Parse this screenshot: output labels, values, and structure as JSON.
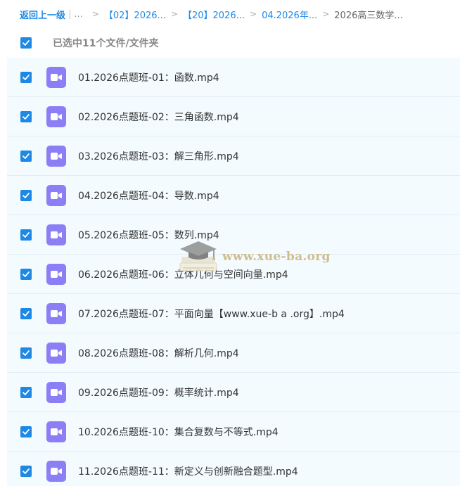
{
  "breadcrumb": {
    "back_label": "返回上一级",
    "separator": "|",
    "ellipsis": "...",
    "crumbs": [
      {
        "label": "【02】2026..."
      },
      {
        "label": "【20】2026..."
      },
      {
        "label": "04.2026年..."
      }
    ],
    "current": "2026高三数学..."
  },
  "selection": {
    "label": "已选中11个文件/文件夹",
    "all_checked": true
  },
  "files": [
    {
      "name": "01.2026点题班-01：函数.mp4",
      "checked": true,
      "icon": "video-file-icon"
    },
    {
      "name": "02.2026点题班-02：三角函数.mp4",
      "checked": true,
      "icon": "video-file-icon"
    },
    {
      "name": "03.2026点题班-03：解三角形.mp4",
      "checked": true,
      "icon": "video-file-icon"
    },
    {
      "name": "04.2026点题班-04：导数.mp4",
      "checked": true,
      "icon": "video-file-icon"
    },
    {
      "name": "05.2026点题班-05：数列.mp4",
      "checked": true,
      "icon": "video-file-icon"
    },
    {
      "name": "06.2026点题班-06：立体几何与空间向量.mp4",
      "checked": true,
      "icon": "video-file-icon"
    },
    {
      "name": "07.2026点题班-07：平面向量【www.xue-b a .org】.mp4",
      "checked": true,
      "icon": "video-file-icon"
    },
    {
      "name": "08.2026点题班-08：解析几何.mp4",
      "checked": true,
      "icon": "video-file-icon"
    },
    {
      "name": "09.2026点题班-09：概率统计.mp4",
      "checked": true,
      "icon": "video-file-icon"
    },
    {
      "name": "10.2026点题班-10：集合复数与不等式.mp4",
      "checked": true,
      "icon": "video-file-icon"
    },
    {
      "name": "11.2026点题班-11：新定义与创新融合题型.mp4",
      "checked": true,
      "icon": "video-file-icon"
    }
  ],
  "watermark": {
    "text": "www.xue-ba.org"
  },
  "colors": {
    "accent": "#1e88e5",
    "video_icon": "#8c7ff5",
    "row_background": "#f3fbfe"
  }
}
